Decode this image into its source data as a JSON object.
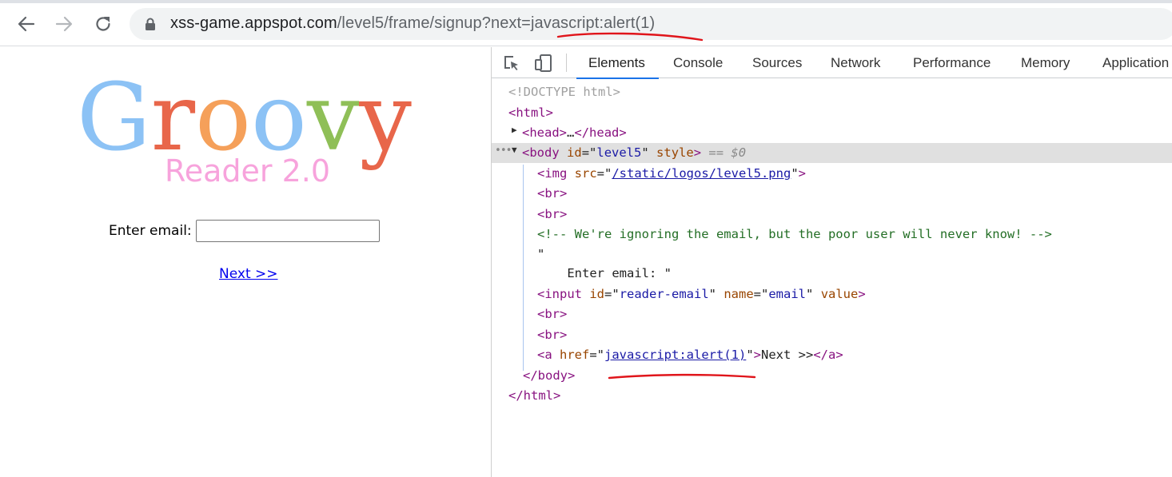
{
  "browser": {
    "url_host": "xss-game.appspot.com",
    "url_path_before": "/level5/frame/signup?next=",
    "url_highlight": "javascript:alert(1)"
  },
  "page": {
    "logo": {
      "title": "Groovy",
      "subtitle": "Reader 2.0"
    },
    "email_label": "Enter email:",
    "email_value": "",
    "next_link": "Next >>"
  },
  "devtools": {
    "tabs": [
      "Elements",
      "Console",
      "Sources",
      "Network",
      "Performance",
      "Memory",
      "Application"
    ],
    "active_tab": "Elements",
    "dom": {
      "doctype": "<!DOCTYPE html>",
      "html_open": "html",
      "head_tag": "head",
      "head_ellipsis": "…",
      "body_tag": "body",
      "body_id": "level5",
      "body_style_attr": "style",
      "console_ref": "== $0",
      "img_src": "/static/logos/level5.png",
      "br": "br",
      "comment": "<!-- We're ignoring the email, but the poor user will never know! -->",
      "quote_open": "\"",
      "text_node": "    Enter email: \"",
      "input_id": "reader-email",
      "input_name": "email",
      "input_value_attr": "value",
      "a_href": "javascript:alert(1)",
      "a_text": "Next >>",
      "body_close": "</body>",
      "html_close": "</html>"
    }
  },
  "colors": {
    "annotation_red": "#e0151b",
    "devtools_tab_underline": "#1a73e8"
  }
}
